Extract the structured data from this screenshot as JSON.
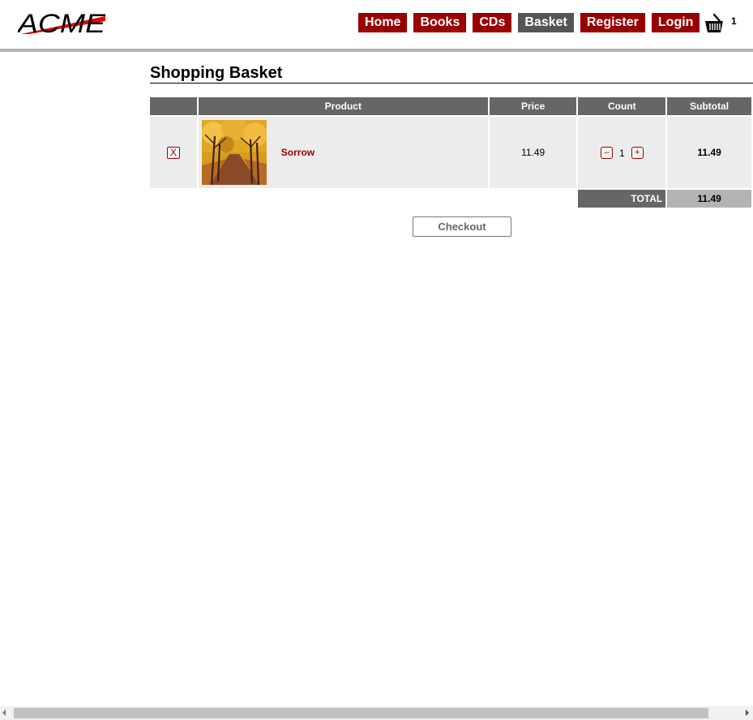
{
  "header": {
    "logo_text": "ACME",
    "nav": [
      {
        "label": "Home",
        "active": false
      },
      {
        "label": "Books",
        "active": false
      },
      {
        "label": "CDs",
        "active": false
      },
      {
        "label": "Basket",
        "active": true
      },
      {
        "label": "Register",
        "active": false
      },
      {
        "label": "Login",
        "active": false
      }
    ],
    "basket_icon": "basket-icon",
    "basket_count": "1"
  },
  "colors": {
    "brand_red": "#990000",
    "nav_active": "#555555",
    "table_header": "#666666",
    "row_bg": "#ececec",
    "total_bg": "#b3b3b3"
  },
  "main": {
    "title": "Shopping Basket",
    "table": {
      "headers": [
        "",
        "Product",
        "Price",
        "Count",
        "Subtotal"
      ],
      "items": [
        {
          "remove_label": "X",
          "product_name": "Sorrow",
          "price": "11.49",
          "count": "1",
          "decrement": "–",
          "increment": "+",
          "subtotal": "11.49"
        }
      ],
      "total_label": "TOTAL",
      "total_value": "11.49"
    },
    "checkout_label": "Checkout"
  }
}
